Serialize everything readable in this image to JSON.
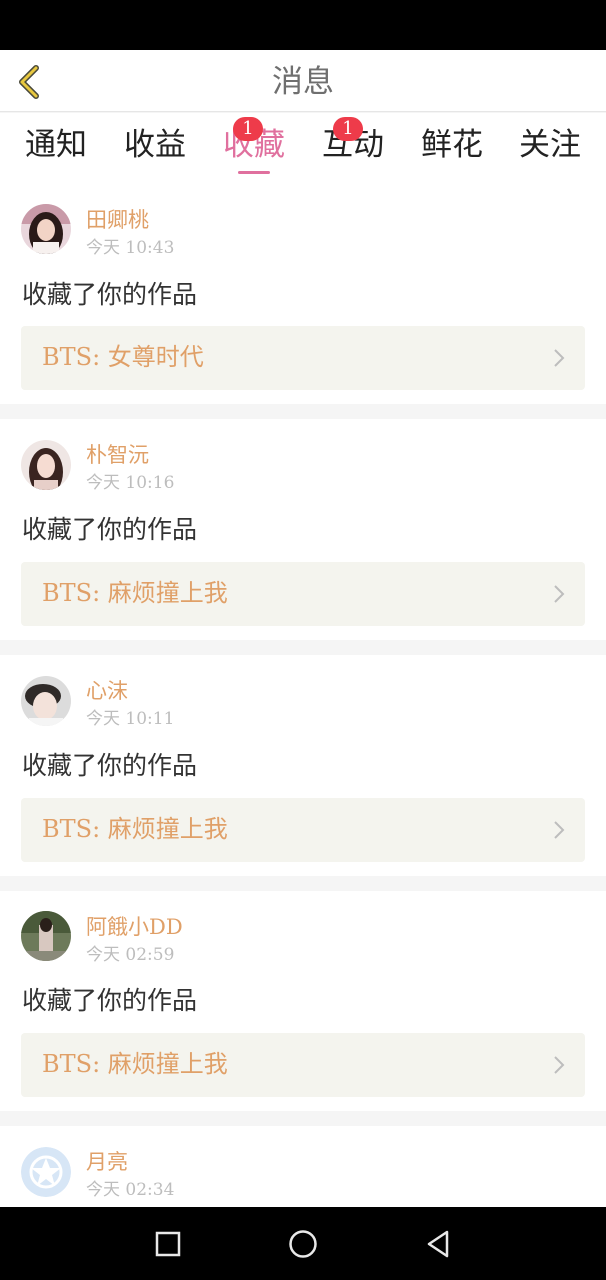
{
  "header": {
    "title": "消息"
  },
  "tabs": [
    {
      "label": "通知",
      "badge": ""
    },
    {
      "label": "收益",
      "badge": ""
    },
    {
      "label": "收藏",
      "badge": "1",
      "active": true
    },
    {
      "label": "互动",
      "badge": "1"
    },
    {
      "label": "鲜花",
      "badge": ""
    },
    {
      "label": "关注",
      "badge": ""
    }
  ],
  "notifications": [
    {
      "name": "田卿桃",
      "time": "今天 10:43",
      "action": "收藏了你的作品",
      "work": "BTS: 女尊时代",
      "avatar": "girl-photo-avatar"
    },
    {
      "name": "朴智沅",
      "time": "今天 10:16",
      "action": "收藏了你的作品",
      "work": "BTS: 麻烦撞上我",
      "avatar": "girl-photo-avatar"
    },
    {
      "name": "心沫",
      "time": "今天 10:11",
      "action": "收藏了你的作品",
      "work": "BTS: 麻烦撞上我",
      "avatar": "boy-photo-avatar"
    },
    {
      "name": "阿餓小DD",
      "time": "今天 02:59",
      "action": "收藏了你的作品",
      "work": "BTS: 麻烦撞上我",
      "avatar": "outdoor-photo-avatar"
    },
    {
      "name": "月亮",
      "time": "今天 02:34",
      "action": "",
      "work": "",
      "avatar": "default-star-avatar"
    }
  ],
  "icons": {
    "back": "chevron-left-icon",
    "row_arrow": "chevron-right-icon",
    "nav": [
      "recents-square-icon",
      "home-circle-icon",
      "back-triangle-icon"
    ]
  },
  "colors": {
    "accent_pink": "#e0709e",
    "name_orange": "#e0a068",
    "badge_red": "#ee3b4a",
    "work_bg": "#f4f4ee"
  }
}
